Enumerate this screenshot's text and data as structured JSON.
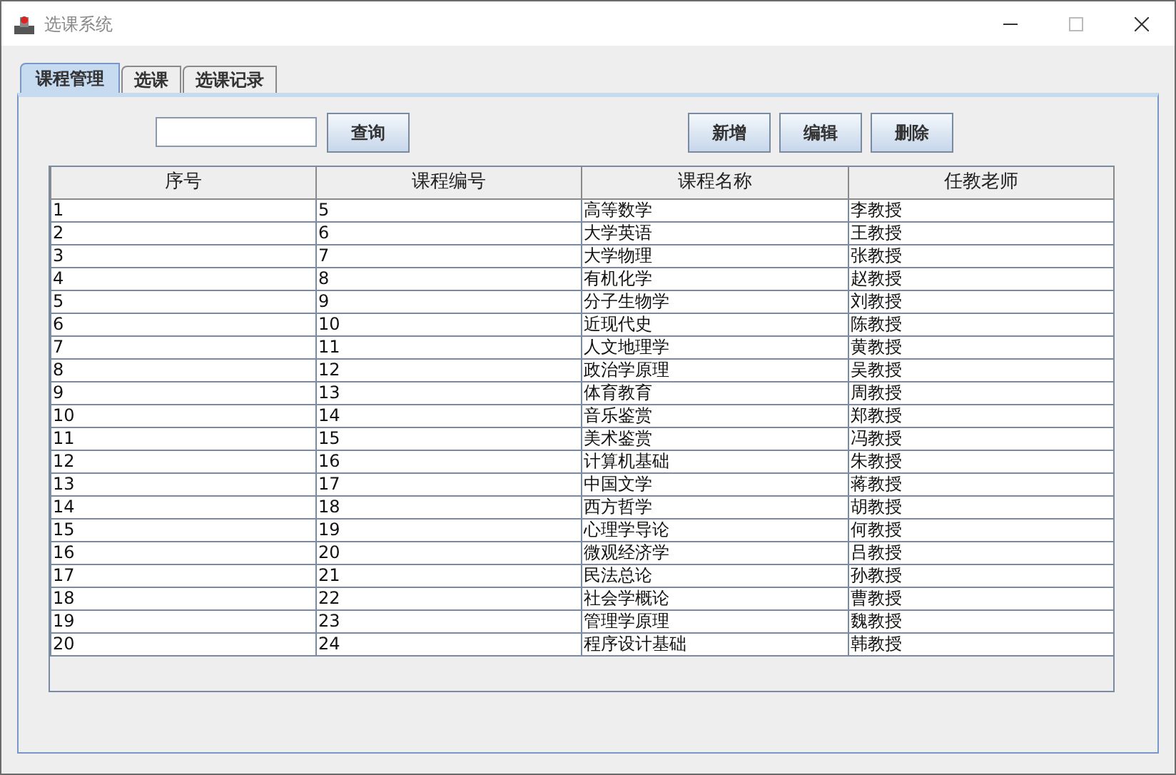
{
  "window": {
    "title": "选课系统"
  },
  "tabs": [
    {
      "label": "课程管理",
      "selected": true
    },
    {
      "label": "选课",
      "selected": false
    },
    {
      "label": "选课记录",
      "selected": false
    }
  ],
  "search_button": "查询",
  "buttons": [
    "新增",
    "编辑",
    "删除"
  ],
  "table": {
    "columns": [
      "序号",
      "课程编号",
      "课程名称",
      "任教老师"
    ],
    "rows": [
      [
        "1",
        "5",
        "高等数学",
        "李教授"
      ],
      [
        "2",
        "6",
        "大学英语",
        "王教授"
      ],
      [
        "3",
        "7",
        "大学物理",
        "张教授"
      ],
      [
        "4",
        "8",
        "有机化学",
        "赵教授"
      ],
      [
        "5",
        "9",
        "分子生物学",
        "刘教授"
      ],
      [
        "6",
        "10",
        "近现代史",
        "陈教授"
      ],
      [
        "7",
        "11",
        "人文地理学",
        "黄教授"
      ],
      [
        "8",
        "12",
        "政治学原理",
        "吴教授"
      ],
      [
        "9",
        "13",
        "体育教育",
        "周教授"
      ],
      [
        "10",
        "14",
        "音乐鉴赏",
        "郑教授"
      ],
      [
        "11",
        "15",
        "美术鉴赏",
        "冯教授"
      ],
      [
        "12",
        "16",
        "计算机基础",
        "朱教授"
      ],
      [
        "13",
        "17",
        "中国文学",
        "蒋教授"
      ],
      [
        "14",
        "18",
        "西方哲学",
        "胡教授"
      ],
      [
        "15",
        "19",
        "心理学导论",
        "何教授"
      ],
      [
        "16",
        "20",
        "微观经济学",
        "吕教授"
      ],
      [
        "17",
        "21",
        "民法总论",
        "孙教授"
      ],
      [
        "18",
        "22",
        "社会学概论",
        "曹教授"
      ],
      [
        "19",
        "23",
        "管理学原理",
        "魏教授"
      ],
      [
        "20",
        "24",
        "程序设计基础",
        "韩教授"
      ]
    ]
  }
}
